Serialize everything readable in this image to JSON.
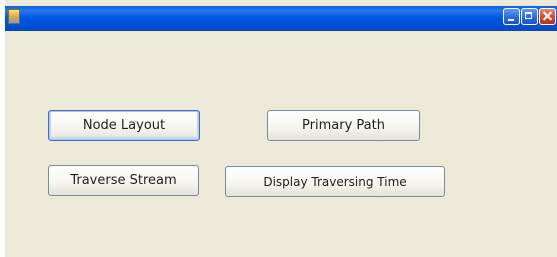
{
  "window": {
    "title": ""
  },
  "titlebar": {
    "icons": {
      "app": "application-icon",
      "minimize": "minimize-icon",
      "maximize": "maximize-icon",
      "close": "close-icon"
    }
  },
  "buttons": {
    "node_layout": "Node Layout",
    "primary_path": "Primary Path",
    "traverse_stream": "Traverse Stream",
    "display_traversing_time": "Display Traversing Time"
  }
}
